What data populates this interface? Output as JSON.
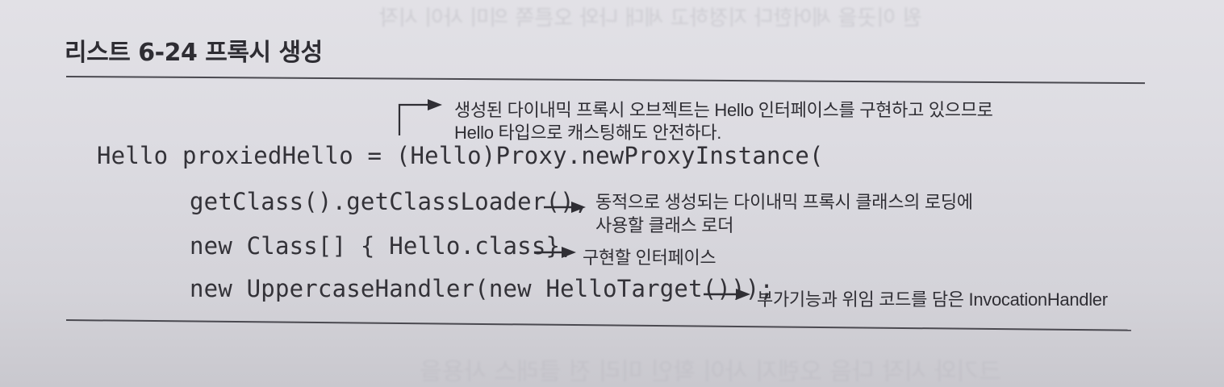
{
  "listing": {
    "title": "리스트 6-24 프록시 생성"
  },
  "code_lines": [
    "Hello proxiedHello = (Hello)Proxy.newProxyInstance(",
    "getClass().getClassLoader(),",
    "new Class[] { Hello.class},",
    "new UppercaseHandler(new HelloTarget()));"
  ],
  "annotations": {
    "cast_note": [
      "생성된 다이내믹 프록시 오브젝트는 Hello 인터페이스를 구현하고 있으므로",
      "Hello 타입으로 캐스팅해도 안전하다."
    ],
    "classloader_note": [
      "동적으로 생성되는 다이내믹 프록시 클래스의 로딩에",
      "사용할 클래스 로더"
    ],
    "interface_note": "구현할 인터페이스",
    "handler_note": "부가기능과 위임 코드를 담은 InvocationHandler"
  },
  "colors": {
    "paper": "#dddce2",
    "ink": "#2e2d33",
    "rule": "#4a4950"
  }
}
